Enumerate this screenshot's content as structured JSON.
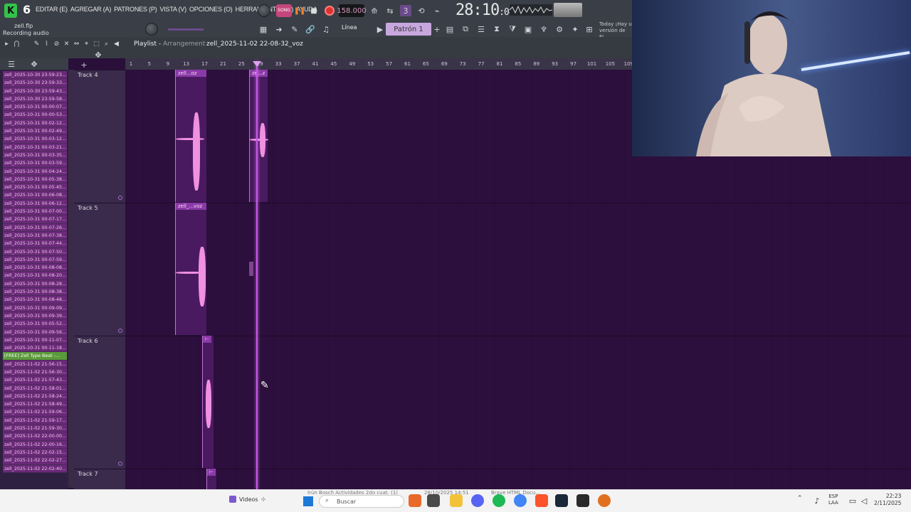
{
  "app": {
    "version": "6",
    "menus": [
      "EDITAR (E)",
      "AGREGAR (A)",
      "PATRONES (P)",
      "VISTA (V)",
      "OPCIONES (O)",
      "HERRAMIENTAS (T)",
      "AYUDA"
    ],
    "mode_label": "SONG",
    "tempo": "158.000",
    "time": "28:10",
    "time_sub": ":04",
    "project_file": "zell.flp",
    "status": "Recording audio",
    "pattern_selector": "Patrón 1",
    "snap_label": "Línea",
    "news": "Today ¡Hay u versión de FL"
  },
  "playlist": {
    "title": "Playlist",
    "subtitle": "Arrangement",
    "current_pattern": "zell_2025-11-02 22-08-32_voz",
    "ruler_ticks": [
      "1",
      "5",
      "9",
      "13",
      "17",
      "21",
      "25",
      "29",
      "33",
      "37",
      "41",
      "45",
      "49",
      "53",
      "57",
      "61",
      "65",
      "69",
      "73",
      "77",
      "81",
      "85",
      "89",
      "93",
      "97",
      "101",
      "105",
      "109"
    ],
    "tracks": [
      {
        "name": "Track 4",
        "clips": [
          "zell...oz",
          "ze...z"
        ]
      },
      {
        "name": "Track 5",
        "clips": [
          "zell_...voz"
        ]
      },
      {
        "name": "Track 6",
        "clips": [
          ""
        ]
      },
      {
        "name": "Track 7",
        "clips": [
          ""
        ]
      }
    ]
  },
  "browser": {
    "items": [
      "zell_2025-10-30 23-59-23...",
      "zell_2025-10-30 23-59-33...",
      "zell_2025-10-30 23-59-43...",
      "zell_2025-10-30 23-59-58...",
      "zell_2025-10-31 00-00-07...",
      "zell_2025-10-31 00-00-53...",
      "zell_2025-10-31 00-02-12...",
      "zell_2025-10-31 00-02-49...",
      "zell_2025-10-31 00-03-12...",
      "zell_2025-10-31 00-03-21...",
      "zell_2025-10-31 00-03-35...",
      "zell_2025-10-31 00-03-59...",
      "zell_2025-10-31 00-04-24...",
      "zell_2025-10-31 00-05-38...",
      "zell_2025-10-31 00-05-45...",
      "zell_2025-10-31 00-06-08...",
      "zell_2025-10-31 00-06-12...",
      "zell_2025-10-31 00-07-00...",
      "zell_2025-10-31 00-07-17...",
      "zell_2025-10-31 00-07-26...",
      "zell_2025-10-31 00-07-38...",
      "zell_2025-10-31 00-07-44...",
      "zell_2025-10-31 00-07-50...",
      "zell_2025-10-31 00-07-59...",
      "zell_2025-10-31 00-08-08...",
      "zell_2025-10-31 00-08-20...",
      "zell_2025-10-31 00-08-28...",
      "zell_2025-10-31 00-08-38...",
      "zell_2025-10-31 00-08-48...",
      "zell_2025-10-31 00-09-09...",
      "zell_2025-10-31 00-09-39...",
      "zell_2025-10-31 00-05-52...",
      "zell_2025-10-31 00-09-56...",
      "zell_2025-10-31 00-11-07...",
      "zell_2025-10-31 00-11-18...",
      "[FREE] Zell Type Beat -...",
      "zell_2025-11-02 21-56-15...",
      "zell_2025-11-02 21-56-30...",
      "zell_2025-11-02 21-57-43...",
      "zell_2025-11-02 21-58-01...",
      "zell_2025-11-02 21-58-24...",
      "zell_2025-11-02 21-58-49...",
      "zell_2025-11-02 21-59-06...",
      "zell_2025-11-02 21-59-17...",
      "zell_2025-11-02 21-59-30...",
      "zell_2025-11-02 22-00-00...",
      "zell_2025-11-02 22-00-16...",
      "zell_2025-11-02 22-02-15...",
      "zell_2025-11-02 22-02-27...",
      "zell_2025-11-02 22-02-40..."
    ],
    "selected_index": 35
  },
  "taskbar": {
    "videos_label": "Videos",
    "search_placeholder": "Buscar",
    "ghost1": "Irún Bosch Actividades 2do cuat. (1)",
    "ghost2": "28/10/2025 14:51",
    "ghost3": "Brave HTML Docu...",
    "lang": "ESP",
    "lang_sub": "LAA",
    "time": "22:23",
    "date": "2/11/2025"
  },
  "colors": {
    "accent": "#c658e8",
    "clip": "#8a3aa8",
    "wave": "#f090e0",
    "record": "#e03030",
    "fl_green": "#33c24a"
  }
}
